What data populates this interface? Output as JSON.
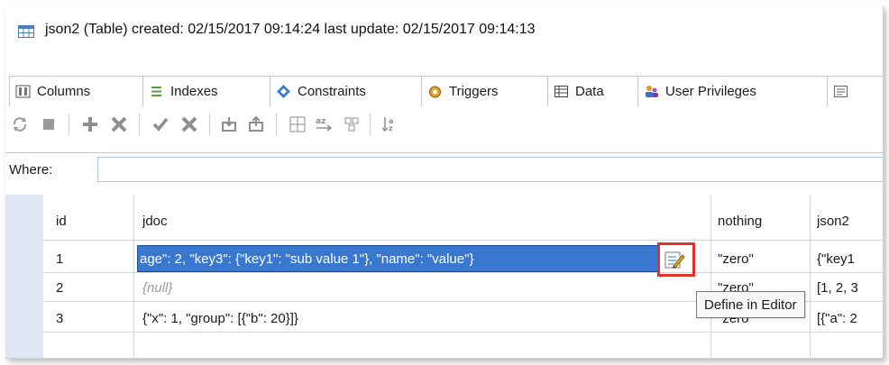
{
  "title": {
    "text": "json2 (Table) created: 02/15/2017 09:14:24 last update: 02/15/2017 09:14:13",
    "icon": "table-icon"
  },
  "tabs": [
    {
      "label": "Columns",
      "icon": "columns-icon"
    },
    {
      "label": "Indexes",
      "icon": "indexes-icon"
    },
    {
      "label": "Constraints",
      "icon": "constraints-icon"
    },
    {
      "label": "Triggers",
      "icon": "triggers-icon"
    },
    {
      "label": "Data",
      "icon": "data-grid-icon",
      "active": true
    },
    {
      "label": "User Privileges",
      "icon": "user-privileges-icon"
    }
  ],
  "toolbar": {
    "icons": [
      "refresh-icon",
      "stop-icon",
      "add-row-icon",
      "delete-row-icon",
      "commit-icon",
      "rollback-icon",
      "import-icon",
      "export-icon",
      "filter-icon",
      "sort-icon",
      "group-icon",
      "order-icon"
    ]
  },
  "where": {
    "label": "Where:",
    "value": ""
  },
  "grid": {
    "headers": [
      "id",
      "jdoc",
      "nothing",
      "json2"
    ],
    "rows": [
      {
        "id": "1",
        "jdoc": "age\": 2, \"key3\": {\"key1\": \"sub value 1\"}, \"name\": \"value\"}",
        "nothing": "\"zero\"",
        "json2": "{\"key1"
      },
      {
        "id": "2",
        "jdoc": "{null}",
        "nothing": "\"zero\"",
        "json2": "[1, 2, 3"
      },
      {
        "id": "3",
        "jdoc": "{\"x\": 1, \"group\": [{\"b\": 20}]}",
        "nothing": "\"zero\"",
        "json2": "[{\"a\": 2"
      }
    ]
  },
  "tooltip": "Define in Editor",
  "colors": {
    "selection": "#3a78d0",
    "highlight": "#e0312d",
    "gutter": "#dde8f4"
  }
}
